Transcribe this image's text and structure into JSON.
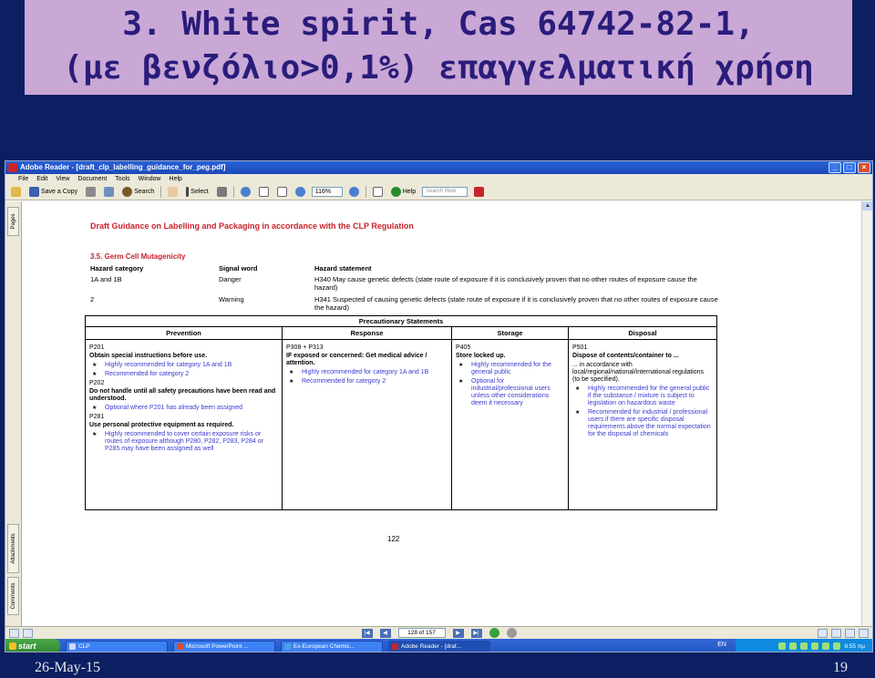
{
  "slide": {
    "title_line1": "3. White spirit, Cas 64742-82-1,",
    "title_line2": "(με βενζόλιο>0,1%) επαγγελματική χρήση",
    "date": "26-May-15",
    "number": "19"
  },
  "window": {
    "title": "Adobe Reader - [draft_clp_labelling_guidance_for_peg.pdf]",
    "menu": [
      "File",
      "Edit",
      "View",
      "Document",
      "Tools",
      "Window",
      "Help"
    ],
    "toolbar": {
      "save_copy": "Save a Copy",
      "search": "Search",
      "select": "Select",
      "zoom": "116%",
      "help": "Help",
      "search_web_placeholder": "Search Web"
    },
    "side_tabs": [
      "Pages",
      "Attachments",
      "Comments"
    ]
  },
  "document": {
    "header": "Draft Guidance on Labelling and Packaging in accordance with the CLP Regulation",
    "section": "3.5. Germ Cell Mutagenicity",
    "hazard_headers": [
      "Hazard category",
      "Signal word",
      "Hazard statement"
    ],
    "hazard_rows": [
      {
        "category": "1A and 1B",
        "signal": "Danger",
        "statement": "H340  May cause genetic defects (state route of exposure if it is conclusively proven that no other routes of exposure cause the hazard)"
      },
      {
        "category": "2",
        "signal": "Warning",
        "statement": "H341  Suspected of causing genetic defects (state route of exposure if it is conclusively proven that no other routes of exposure cause the hazard)"
      }
    ],
    "precautionary_title": "Precautionary Statements",
    "columns": {
      "prevention": {
        "head": "Prevention",
        "p201_code": "P201",
        "p201_stmt": "Obtain special instructions before use.",
        "p201_note1": "Highly recommended for category 1A and 1B",
        "p201_note2": "Recommended for category 2",
        "p202_code": "P202",
        "p202_stmt": "Do not handle until all safety precautions have been read and understood.",
        "p202_note": "Optional where P201 has already been assigned",
        "p281_code": "P281",
        "p281_stmt": "Use personal protective equipment as required.",
        "p281_note": "Highly recommended to cover certain exposure risks or routes of exposure although P280, P282, P283, P284 or P285 may have been assigned as well"
      },
      "response": {
        "head": "Response",
        "code": "P308 + P313",
        "stmt": "IF exposed or concerned: Get medical advice / attention.",
        "note1": "Highly recommended for category 1A and 1B",
        "note2": "Recommended for category 2"
      },
      "storage": {
        "head": "Storage",
        "code": "P405",
        "stmt": "Store locked up.",
        "note1": "Highly recommended for the general public",
        "note2": "Optional for industrial/professional users unless other considerations deem it necessary"
      },
      "disposal": {
        "head": "Disposal",
        "code": "P501",
        "stmt": "Dispose of contents/container to ...",
        "detail": "... in accordance with local/regional/national/international regulations (to be specified).",
        "note1": "Highly recommended for the general public if the substance / mixture is subject to legislation on hazardous waste",
        "note2": "Recommended for industrial / professional users if there are specific disposal requirements above the normal expectation for the disposal of chemicals"
      }
    },
    "page_number": "122"
  },
  "navigation": {
    "page_indicator": "128 of 157"
  },
  "taskbar": {
    "start": "start",
    "items": [
      "CLP",
      "Microsoft PowerPoint ...",
      "Ex-European Chemic...",
      "Adobe Reader - [draf..."
    ],
    "language": "EN",
    "clock": "8:55 πμ"
  }
}
